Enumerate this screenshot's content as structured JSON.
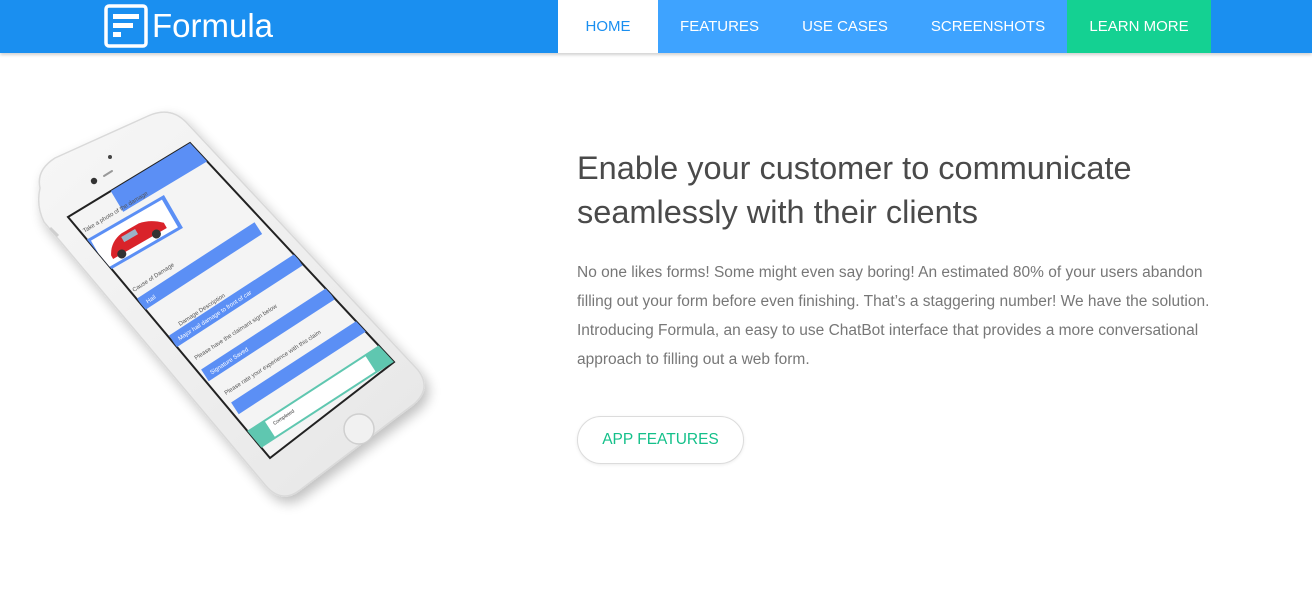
{
  "brand": {
    "name": "Formula"
  },
  "nav": {
    "items": [
      {
        "label": "HOME",
        "active": true
      },
      {
        "label": "FEATURES"
      },
      {
        "label": "USE CASES"
      },
      {
        "label": "SCREENSHOTS"
      },
      {
        "label": "LEARN MORE"
      }
    ]
  },
  "hero": {
    "title": "Enable your customer to communicate seamlessly with their clients",
    "text": "No one likes forms! Some might even say boring! An estimated 80% of your users abandon filling out your form before even finishing. That’s a staggering number! We have the solution. Introducing Formula, an easy to use ChatBot interface that provides a more conversational approach to filling out a web form.",
    "cta_label": "APP FEATURES"
  },
  "phone_screen": {
    "rows": [
      "Take a photo of the damage",
      "Cause of Damage",
      "Hail",
      "Damage Description",
      "Major hail damage to front of car",
      "Please have the claimant sign below",
      "Signature Saved",
      "Please rate your experience with this claim",
      "Completed"
    ]
  },
  "colors": {
    "nav_bg": "#1a8ff0",
    "nav_item_bg": "#3ea3ff",
    "learn_more_bg": "#14d192",
    "cta_text": "#14c08a",
    "bubble_blue": "#5b8ff5"
  }
}
